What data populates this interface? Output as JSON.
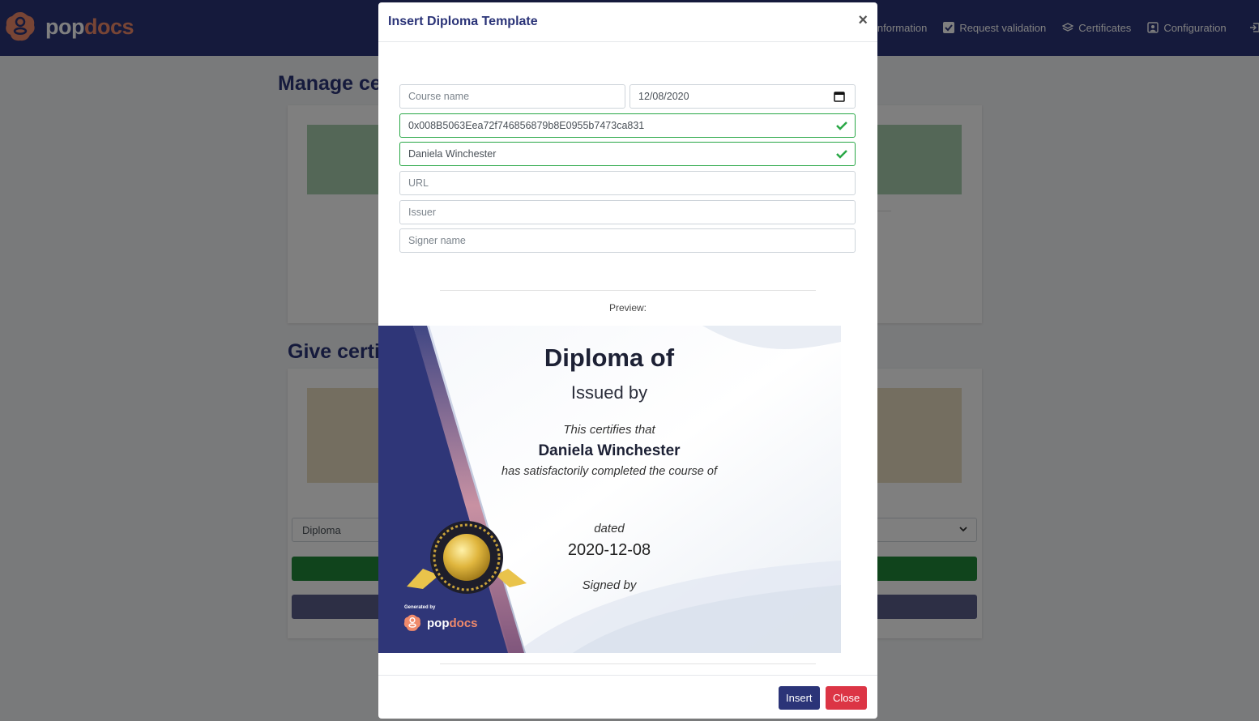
{
  "navbar": {
    "brand": {
      "pop": "pop",
      "docs": "docs"
    },
    "links": [
      {
        "label": "information",
        "icon": "info-icon"
      },
      {
        "label": "Request validation",
        "icon": "checkbox-icon"
      },
      {
        "label": "Certificates",
        "icon": "layers-icon"
      },
      {
        "label": "Configuration",
        "icon": "user-config-icon"
      }
    ]
  },
  "background": {
    "manage_title": "Manage ce",
    "give_title": "Give certi",
    "template_select": "Diploma",
    "colors": {
      "green_panel": "#a9cfae",
      "yellow_panel": "#e8dcc0",
      "green_button": "#218838",
      "navy_button": "#5a5f8a"
    }
  },
  "modal": {
    "title": "Insert Diploma Template",
    "close_symbol": "×",
    "fields": {
      "course_name": {
        "placeholder": "Course name",
        "value": ""
      },
      "date": {
        "value": "12/08/2020"
      },
      "wallet_address": {
        "value": "0x008B5063Eea72f746856879b8E0955b7473ca831"
      },
      "recipient_name": {
        "value": "Daniela Winchester"
      },
      "url": {
        "placeholder": "URL",
        "value": ""
      },
      "issuer": {
        "placeholder": "Issuer",
        "value": ""
      },
      "signer_name": {
        "placeholder": "Signer name",
        "value": ""
      }
    },
    "preview_label": "Preview:",
    "diploma": {
      "title": "Diploma of",
      "issued_by": "Issued by",
      "certifies": "This certifies that",
      "recipient": "Daniela Winchester",
      "completed": "has satisfactorily completed the course of",
      "dated": "dated",
      "date": "2020-12-08",
      "signed_by": "Signed by",
      "generated_by": "Generated by",
      "brand": {
        "pop": "pop",
        "docs": "docs"
      }
    },
    "buttons": {
      "insert": "Insert",
      "close": "Close"
    }
  },
  "theme": {
    "primary": "#2b3478",
    "accent": "#f08a6b",
    "danger": "#dc3545",
    "success": "#28a745"
  }
}
